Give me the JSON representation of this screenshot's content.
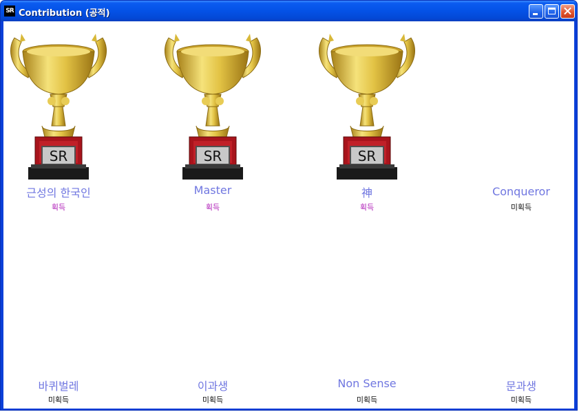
{
  "window": {
    "app_icon_text": "SR",
    "title": "Contribution (공적)"
  },
  "trophy_plate_text": "SR",
  "achievements": [
    {
      "name": "근성의 한국인",
      "status": "획득",
      "acquired": true
    },
    {
      "name": "Master",
      "status": "획득",
      "acquired": true
    },
    {
      "name": "神",
      "status": "획득",
      "acquired": true
    },
    {
      "name": "Conqueror",
      "status": "미획득",
      "acquired": false
    },
    {
      "name": "바퀴벌레",
      "status": "미획득",
      "acquired": false
    },
    {
      "name": "이과생",
      "status": "미획득",
      "acquired": false
    },
    {
      "name": "Non Sense",
      "status": "미획득",
      "acquired": false
    },
    {
      "name": "문과생",
      "status": "미획득",
      "acquired": false
    }
  ],
  "colors": {
    "title_bar": "#0452e6",
    "name_text": "#6f76e0",
    "acquired_text": "#b020b8",
    "not_acquired_text": "#111111",
    "trophy_gold": "#e0c040",
    "trophy_base": "#b01818"
  }
}
